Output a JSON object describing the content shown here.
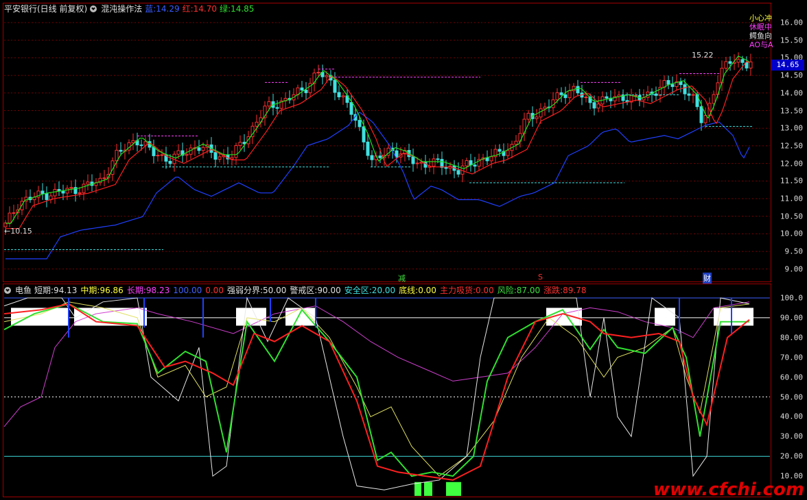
{
  "main_panel": {
    "stock_title": "平安银行(日线 前复权)",
    "indicator_name": "混沌操作法",
    "legend": [
      {
        "label": "蓝",
        "value": "14.29",
        "color": "#3a5cff"
      },
      {
        "label": "红",
        "value": "14.70",
        "color": "#ff3030"
      },
      {
        "label": "绿",
        "value": "14.85",
        "color": "#30e030"
      }
    ],
    "right_labels": [
      "小心冲",
      "休眠中",
      "鳄鱼向",
      "AO与A"
    ],
    "high_label": "15.22",
    "low_label": "10.15",
    "current_price": "14.65",
    "bottom_markers": [
      "减",
      "S",
      "财"
    ],
    "y_ticks": [
      "16.00",
      "15.50",
      "15.00",
      "14.50",
      "14.00",
      "13.50",
      "13.00",
      "12.50",
      "12.00",
      "11.50",
      "11.00",
      "10.50",
      "10.00",
      "9.50",
      "9.00"
    ]
  },
  "sub_panel": {
    "indicator_name": "电鱼",
    "fields": [
      {
        "label": "短期",
        "value": "94.13",
        "color": "#e0e0e0"
      },
      {
        "label": "中期",
        "value": "96.86",
        "color": "#ffff40"
      },
      {
        "label": "长期",
        "value": "98.23",
        "color": "#ff40ff"
      },
      {
        "label": "",
        "value": "100.00",
        "color": "#4060ff"
      },
      {
        "label": "",
        "value": "0.00",
        "color": "#ff3030"
      },
      {
        "label": "强弱分界",
        "value": "50.00",
        "color": "#e0e0e0"
      },
      {
        "label": "警戒区",
        "value": "90.00",
        "color": "#e0e0e0"
      },
      {
        "label": "安全区",
        "value": "20.00",
        "color": "#40e0e0"
      },
      {
        "label": "底线",
        "value": "0.00",
        "color": "#ffff40"
      },
      {
        "label": "主力吸货",
        "value": "0.00",
        "color": "#ff3030"
      },
      {
        "label": "风险",
        "value": "87.00",
        "color": "#40e040"
      },
      {
        "label": "涨跌",
        "value": "89.78",
        "color": "#ff3030"
      }
    ],
    "y_ticks": [
      "100.0",
      "90.00",
      "80.00",
      "70.00",
      "60.00",
      "50.00",
      "40.00",
      "30.00",
      "20.00",
      "10.00"
    ]
  },
  "watermark": "www.cfchi.com",
  "colors": {
    "frame": "#a00000",
    "up_candle": "#ff3030",
    "down_candle": "#40e0e0",
    "blue_line": "#2040ff",
    "red_line": "#ff2020",
    "green_line": "#20e020",
    "fractal_up": "#ff40ff",
    "fractal_down": "#40e0e0"
  }
}
